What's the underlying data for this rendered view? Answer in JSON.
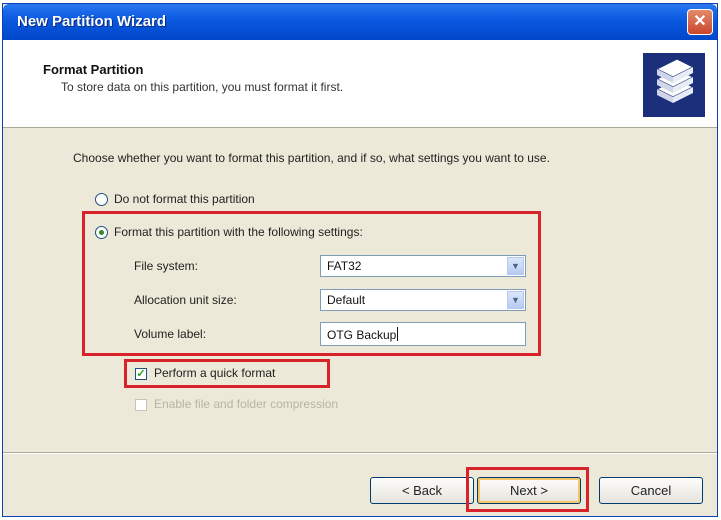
{
  "window": {
    "title": "New Partition Wizard"
  },
  "header": {
    "title": "Format Partition",
    "subtitle": "To store data on this partition, you must format it first."
  },
  "intro": "Choose whether you want to format this partition, and if so, what settings you want to use.",
  "options": {
    "no_format_label": "Do not format this partition",
    "no_format_selected": false,
    "format_label": "Format this partition with the following settings:",
    "format_selected": true
  },
  "settings": {
    "file_system_label": "File system:",
    "file_system_value": "FAT32",
    "allocation_label": "Allocation unit size:",
    "allocation_value": "Default",
    "volume_label_label": "Volume label:",
    "volume_label_value": "OTG Backup"
  },
  "checkboxes": {
    "quick_format_label": "Perform a quick format",
    "quick_format_checked": true,
    "compression_label": "Enable file and folder compression",
    "compression_checked": false,
    "compression_enabled": false
  },
  "buttons": {
    "back": "< Back",
    "next": "Next >",
    "cancel": "Cancel"
  },
  "colors": {
    "highlight_red": "#d8232a",
    "titlebar_blue": "#0a58e0",
    "dialog_bg": "#ece9d8"
  }
}
